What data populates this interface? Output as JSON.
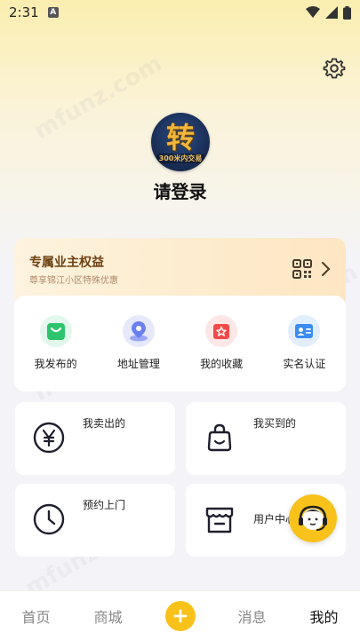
{
  "status_bar": {
    "time": "2:31",
    "notification_letter": "A"
  },
  "profile": {
    "avatar_char": "转",
    "avatar_sub": "300米内交易",
    "login_text": "请登录"
  },
  "owner_benefit": {
    "title": "专属业主权益",
    "subtitle": "尊享锦江小区特殊优惠"
  },
  "quick_actions": [
    {
      "label": "我发布的",
      "icon": "shopping-bag-icon",
      "color": "#2ec46d"
    },
    {
      "label": "地址管理",
      "icon": "location-pin-icon",
      "color": "#6a7ff0"
    },
    {
      "label": "我的收藏",
      "icon": "star-box-icon",
      "color": "#f04a4a"
    },
    {
      "label": "实名认证",
      "icon": "id-card-icon",
      "color": "#3a8cf0"
    }
  ],
  "grid": {
    "sold": "我卖出的",
    "bought": "我买到的",
    "appointment": "预约上门",
    "user_center": "用户中心"
  },
  "tabbar": {
    "home": "首页",
    "mall": "商城",
    "messages": "消息",
    "mine": "我的"
  },
  "watermark": "mfunz.com",
  "colors": {
    "accent": "#f8c21b",
    "owner_title": "#6b3f10"
  }
}
